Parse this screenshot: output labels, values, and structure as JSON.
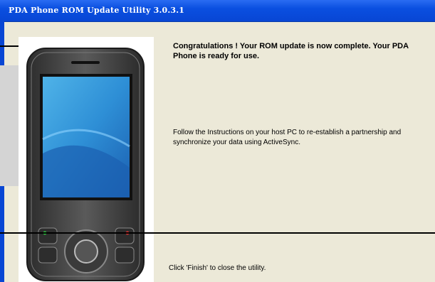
{
  "window": {
    "title": "PDA Phone ROM Update Utility 3.0.3.1"
  },
  "content": {
    "heading": "Congratulations ! Your ROM update is now complete. Your PDA Phone is ready for use.",
    "instructions": "Follow the Instructions on your host PC to re-establish a partnership and synchronize your data using ActiveSync.",
    "finish_note": "Click 'Finish' to close the utility."
  },
  "colors": {
    "titlebar": "#0a4fe0",
    "dialog_bg": "#ece9d8"
  }
}
